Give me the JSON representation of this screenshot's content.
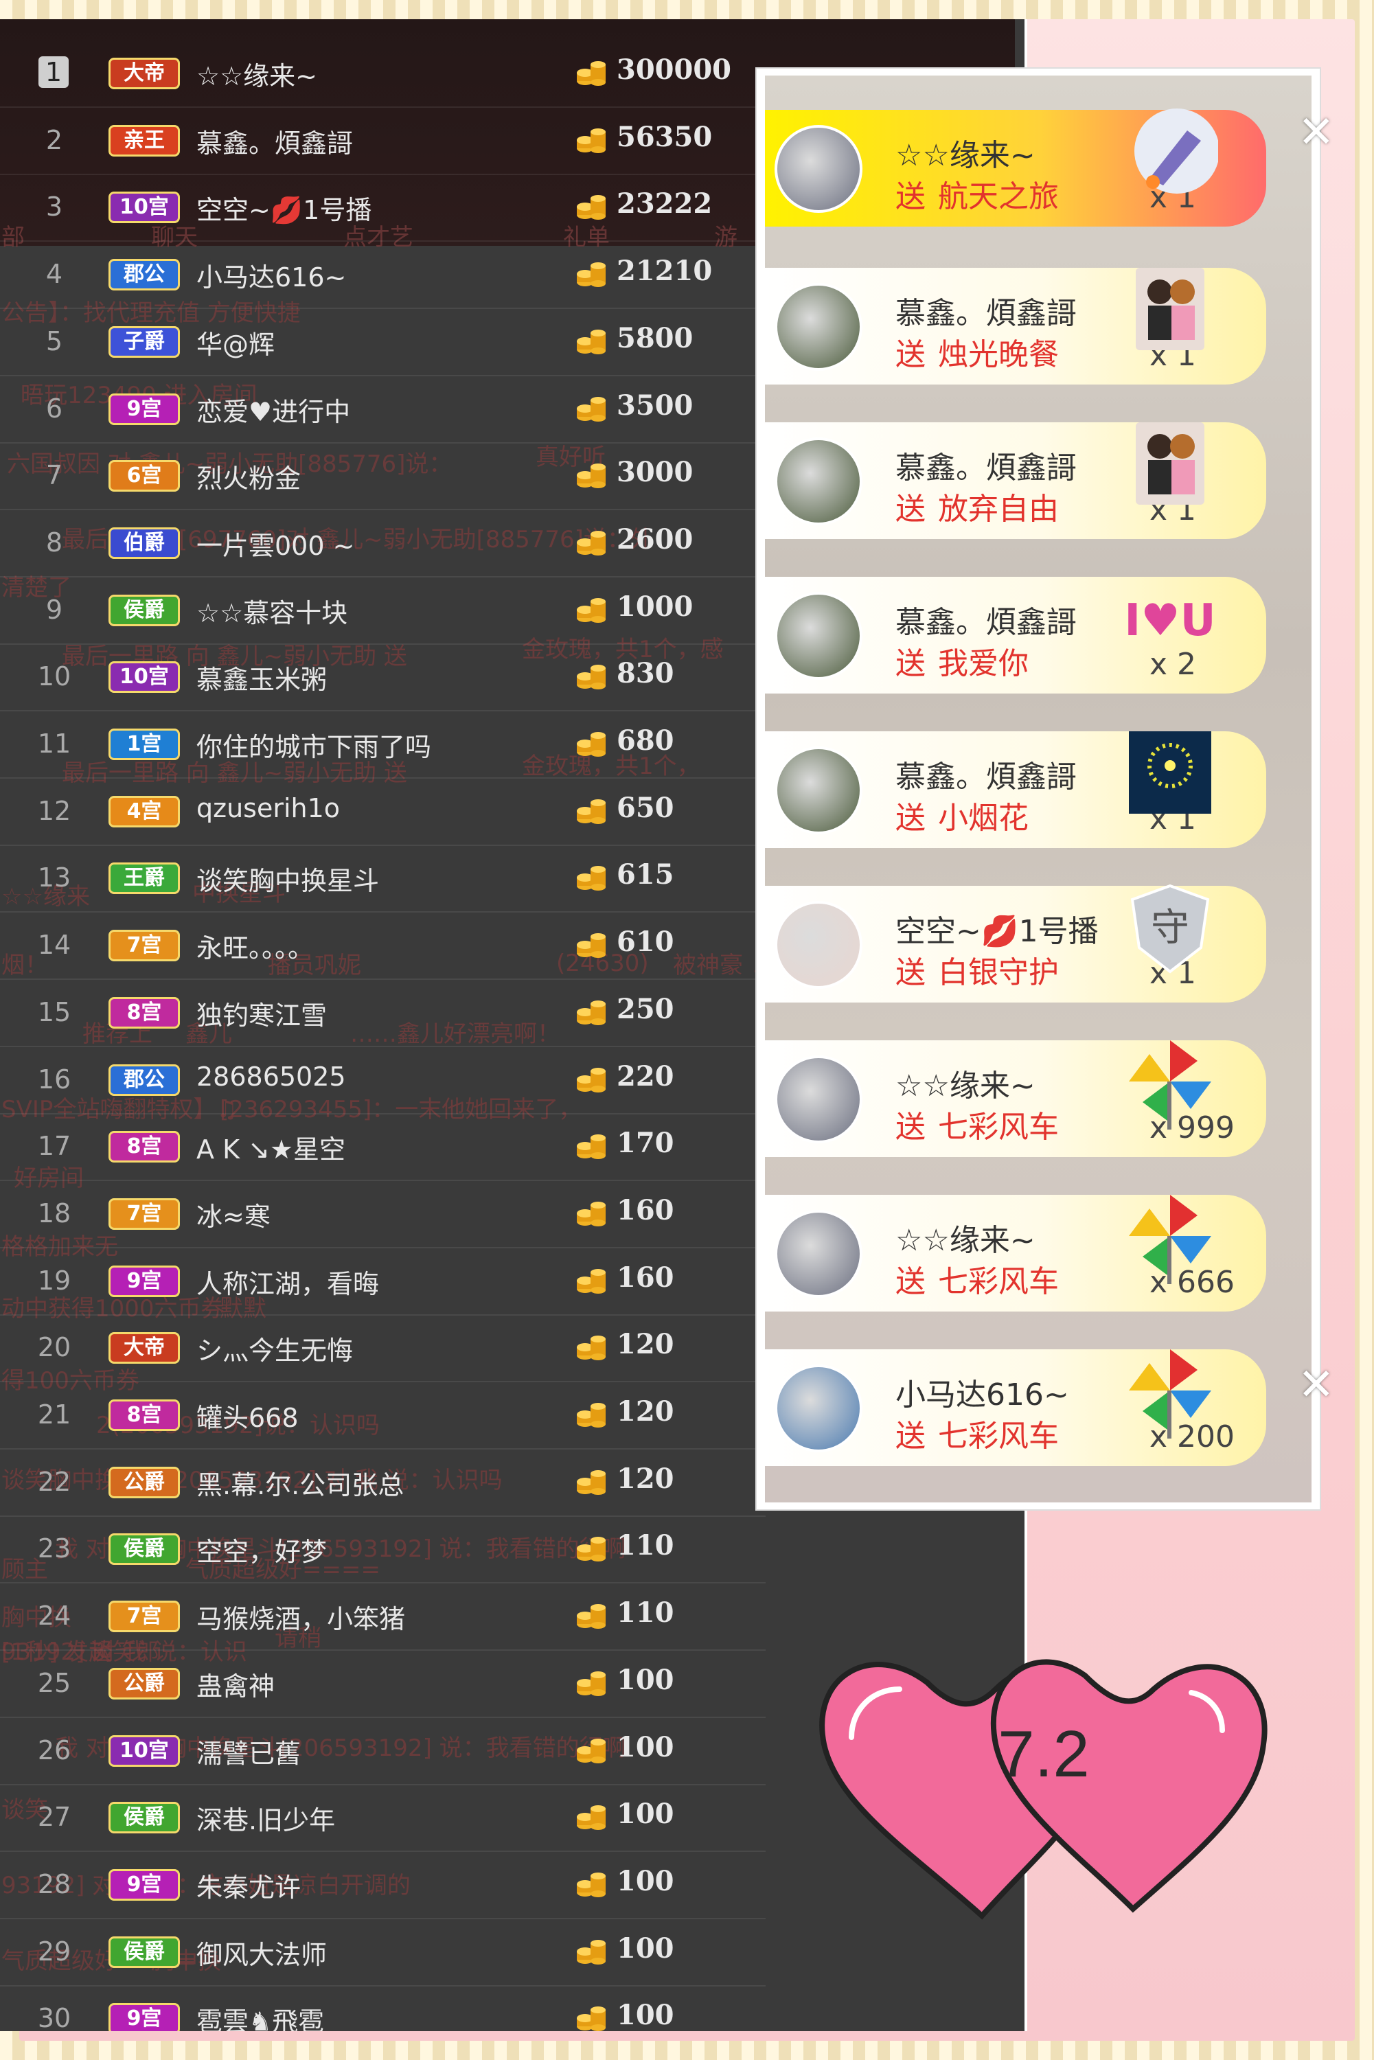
{
  "leaderboard": [
    {
      "rank": "1",
      "badge": "大帝",
      "name": "☆☆缘来~",
      "score": "300000"
    },
    {
      "rank": "2",
      "badge": "亲王",
      "name": "慕鑫。煩鑫謌",
      "score": "56350"
    },
    {
      "rank": "3",
      "badge": "10宫",
      "name": "空空~💋1号播",
      "score": "23222"
    },
    {
      "rank": "4",
      "badge": "郡公",
      "name": "小马达616~",
      "score": "21210"
    },
    {
      "rank": "5",
      "badge": "子爵",
      "name": "华@辉",
      "score": "5800"
    },
    {
      "rank": "6",
      "badge": "9宫",
      "name": "恋爱♥进行中",
      "score": "3500"
    },
    {
      "rank": "7",
      "badge": "6宫",
      "name": "烈火粉金",
      "score": "3000"
    },
    {
      "rank": "8",
      "badge": "伯爵",
      "name": "一片雲000 ~",
      "score": "2600"
    },
    {
      "rank": "9",
      "badge": "侯爵",
      "name": "☆☆慕容十块",
      "score": "1000"
    },
    {
      "rank": "10",
      "badge": "10宫",
      "name": "慕鑫玉米粥",
      "score": "830"
    },
    {
      "rank": "11",
      "badge": "1宫",
      "name": "你住的城市下雨了吗",
      "score": "680"
    },
    {
      "rank": "12",
      "badge": "4宫",
      "name": "qzuserih1o",
      "score": "650"
    },
    {
      "rank": "13",
      "badge": "王爵",
      "name": "谈笑胸中换星斗",
      "score": "615"
    },
    {
      "rank": "14",
      "badge": "7宫",
      "name": "永旺。。。。",
      "score": "610"
    },
    {
      "rank": "15",
      "badge": "8宫",
      "name": "独钓寒江雪",
      "score": "250"
    },
    {
      "rank": "16",
      "badge": "郡公",
      "name": "286865025",
      "score": "220"
    },
    {
      "rank": "17",
      "badge": "8宫",
      "name": "A K ↘★星空",
      "score": "170"
    },
    {
      "rank": "18",
      "badge": "7宫",
      "name": "冰≈寒",
      "score": "160"
    },
    {
      "rank": "19",
      "badge": "9宫",
      "name": "人称江湖，看晦",
      "score": "160"
    },
    {
      "rank": "20",
      "badge": "大帝",
      "name": "シ灬今生无悔",
      "score": "120"
    },
    {
      "rank": "21",
      "badge": "8宫",
      "name": "罐头668",
      "score": "120"
    },
    {
      "rank": "22",
      "badge": "公爵",
      "name": "黑.幕.尔.公司张总",
      "score": "120"
    },
    {
      "rank": "23",
      "badge": "侯爵",
      "name": "空空，好梦",
      "score": "110"
    },
    {
      "rank": "24",
      "badge": "7宫",
      "name": "马猴烧酒，小笨猪",
      "score": "110"
    },
    {
      "rank": "25",
      "badge": "公爵",
      "name": "蛊禽神",
      "score": "100"
    },
    {
      "rank": "26",
      "badge": "10宫",
      "name": "濡譬已舊",
      "score": "100"
    },
    {
      "rank": "27",
      "badge": "侯爵",
      "name": "深巷.旧少年",
      "score": "100"
    },
    {
      "rank": "28",
      "badge": "9宫",
      "name": "朱秦尤许",
      "score": "100"
    },
    {
      "rank": "29",
      "badge": "侯爵",
      "name": "御风大法师",
      "score": "100"
    },
    {
      "rank": "30",
      "badge": "9宫",
      "name": "雹雲♞飛雹",
      "score": "100"
    }
  ],
  "badge_colors": {
    "大帝": "#c93c20",
    "亲王": "#d9401f",
    "10宫": "#8a2bb0",
    "郡公": "#2a6fd6",
    "子爵": "#3d52d8",
    "9宫": "#b520b5",
    "6宫": "#e07c1a",
    "伯爵": "#3a4bd0",
    "侯爵": "#41a630",
    "1宫": "#1f7fd4",
    "4宫": "#e68a19",
    "王爵": "#3aa93a",
    "7宫": "#e5901c",
    "8宫": "#c02a9e",
    "公爵": "#d46a1e"
  },
  "background_ghost_text": [
    "部",
    "聊天",
    "点才艺",
    "礼单",
    "游",
    "公告】：找代理充值 方便快捷",
    "晤玩123490 进入房间",
    "六国叔因 对 鑫儿~弱小无助[885776]说：",
    "真好听",
    "最后一里路[697760]对 鑫儿~弱小无助[885776]说：外",
    "清楚了",
    "最后一里路 向 鑫儿~弱小无助 送",
    "金玫瑰，共1个，感",
    "最后一里路 向 鑫儿~弱小无助 送",
    "金玫瑰，共1个，",
    "☆☆缘来",
    "中换星斗",
    "烟！",
    "播员巩妮",
    "(24630)",
    "被神豪 ♫♫ 〜牛嗯",
    "推荐上",
    "鑫儿",
    "……鑫儿好漂亮啊！",
    "SVIP全站嗨翻特权】♫",
    "[236293455]：一末他她回来了，",
    "好房间",
    "格格加来无",
    "动中获得1000六币券",
    "默默",
    "得100六币券",
    "2(206593192]说：认识吗",
    "谈笑胸中换星斗[206593192] 对 我 说：认识吗",
    "我 对 谈笑胸中换星斗[206593192] 说：我看错的行啊",
    "顾主",
    "气质超级好====",
    "胸中换",
    "请稍",
    "[1秒]  发起",
    "谈笑郎",
    "93192] 对 我 说：认识",
    "我 对 谈笑胸中换星斗[206593192] 说：我看错的行啊",
    "谈笑",
    "93192] 对 我 说：方小姐是凉白开调的",
    "气质超级好====",
    "胸中换",
    "请稍",
    "发起"
  ],
  "gifts": [
    {
      "sender": "☆☆缘来~",
      "send_word": "送",
      "gift": "航天之旅",
      "count": "x 1",
      "highlight": true,
      "icon": "rocket-icon"
    },
    {
      "sender": "慕鑫。煩鑫謌",
      "send_word": "送",
      "gift": "烛光晚餐",
      "count": "x 1",
      "highlight": false,
      "icon": "couple-dinner-icon"
    },
    {
      "sender": "慕鑫。煩鑫謌",
      "send_word": "送",
      "gift": "放弃自由",
      "count": "x 1",
      "highlight": false,
      "icon": "couple-icon"
    },
    {
      "sender": "慕鑫。煩鑫謌",
      "send_word": "送",
      "gift": "我爱你",
      "count": "x 2",
      "highlight": false,
      "icon": "i-love-u-icon",
      "icon_text": "I♥U"
    },
    {
      "sender": "慕鑫。煩鑫謌",
      "send_word": "送",
      "gift": "小烟花",
      "count": "x 1",
      "highlight": false,
      "icon": "firework-icon"
    },
    {
      "sender": "空空~💋1号播",
      "send_word": "送",
      "gift": "白银守护",
      "count": "x 1",
      "highlight": false,
      "icon": "shield-icon",
      "icon_text": "守"
    },
    {
      "sender": "☆☆缘来~",
      "send_word": "送",
      "gift": "七彩风车",
      "count": "x 999",
      "highlight": false,
      "icon": "pinwheel-icon"
    },
    {
      "sender": "☆☆缘来~",
      "send_word": "送",
      "gift": "七彩风车",
      "count": "x 666",
      "highlight": false,
      "icon": "pinwheel-icon"
    },
    {
      "sender": "小马达616~",
      "send_word": "送",
      "gift": "七彩风车",
      "count": "x 200",
      "highlight": false,
      "icon": "pinwheel-icon"
    }
  ],
  "close_glyph": "✕",
  "heart_label": "7.2",
  "colors": {
    "send_red": "#e2332d",
    "gold": "#f2b324",
    "heart_pink": "#f26a9a"
  }
}
